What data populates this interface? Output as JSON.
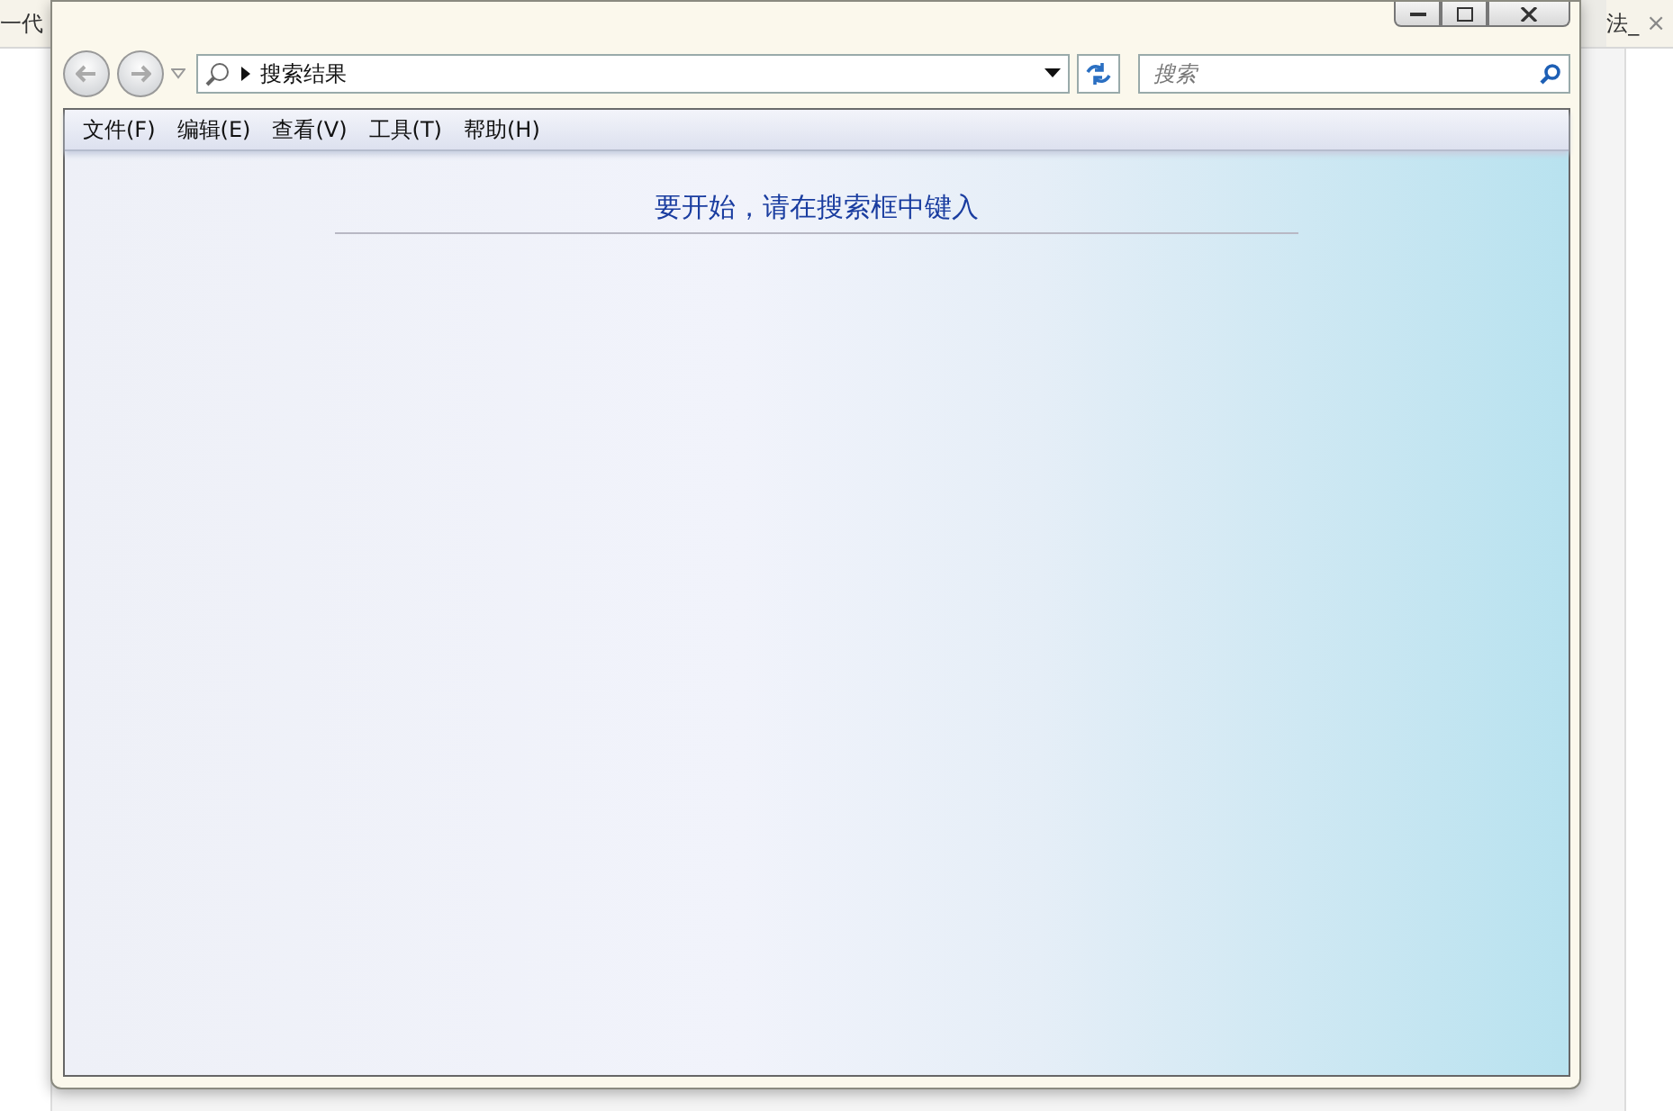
{
  "background_browser": {
    "tabs": [
      {
        "label": "一代"
      },
      {
        "label": "法_",
        "close": "×"
      }
    ]
  },
  "window": {
    "controls": [
      {
        "kind": "minimize"
      },
      {
        "kind": "maximize"
      },
      {
        "kind": "close"
      }
    ]
  },
  "address_bar": {
    "path": "搜索结果"
  },
  "search": {
    "placeholder": "搜索"
  },
  "menu": [
    {
      "label": "文件(F)"
    },
    {
      "label": "编辑(E)"
    },
    {
      "label": "查看(V)"
    },
    {
      "label": "工具(T)"
    },
    {
      "label": "帮助(H)"
    }
  ],
  "content": {
    "message": "要开始，请在搜索框中键入"
  }
}
